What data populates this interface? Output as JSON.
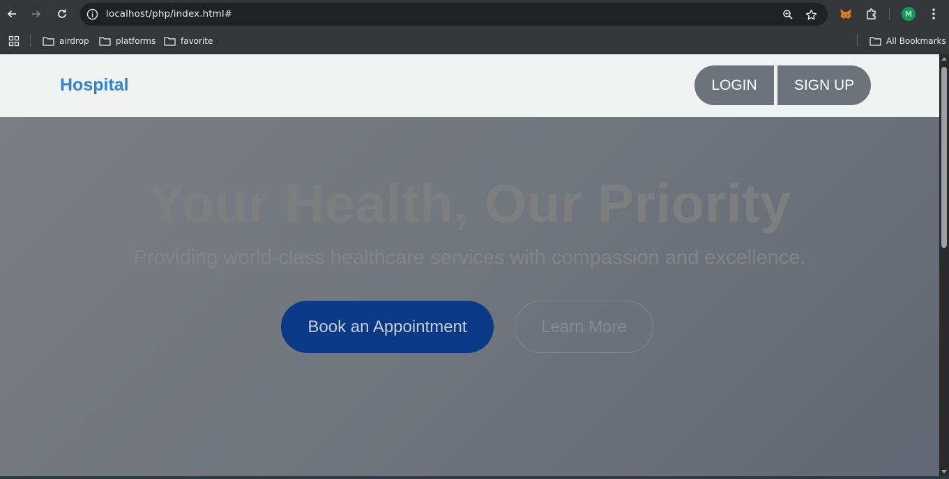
{
  "browser": {
    "url": "localhost/php/index.html#",
    "bookmarks": [
      {
        "label": "airdrop"
      },
      {
        "label": "platforms"
      },
      {
        "label": "favorite"
      }
    ],
    "all_bookmarks_label": "All Bookmarks",
    "profile_initial": "M",
    "icons": [
      "back-icon",
      "forward-icon",
      "reload-icon",
      "site-info-icon",
      "zoom-icon",
      "star-icon",
      "metamask-icon",
      "extensions-icon",
      "menu-icon",
      "apps-grid-icon",
      "folder-icon"
    ]
  },
  "site": {
    "logo": "Hospital",
    "login_label": "LOGIN",
    "signup_label": "SIGN UP"
  },
  "hero": {
    "title": "Your Health, Our Priority",
    "subtitle": "Providing world-class healthcare services with compassion and excellence.",
    "primary_cta": "Book an Appointment",
    "secondary_cta": "Learn More"
  },
  "colors": {
    "logo": "#2f84d4",
    "header_button": "#6c737b",
    "primary_cta": "#0a3a87"
  }
}
